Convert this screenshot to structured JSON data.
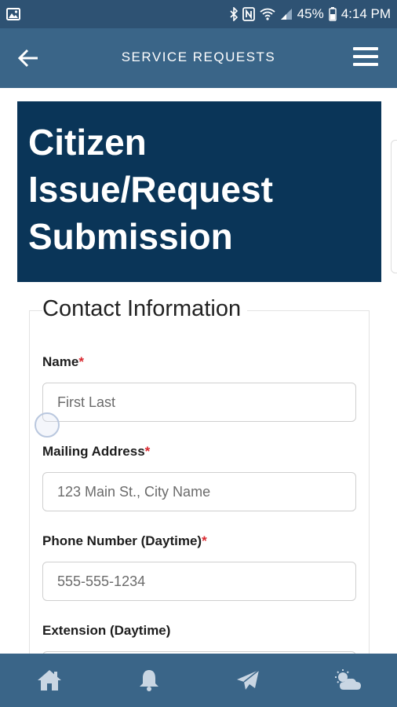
{
  "status_bar": {
    "battery": "45%",
    "time": "4:14 PM",
    "icons": [
      "image-icon",
      "bluetooth-icon",
      "nfc-icon",
      "wifi-icon",
      "signal-icon",
      "battery-icon"
    ]
  },
  "app_bar": {
    "title": "SERVICE REQUESTS",
    "back_icon": "back-arrow-icon",
    "menu_icon": "hamburger-menu-icon"
  },
  "hero": {
    "title_line1": "Citizen",
    "title_line2": "Issue/Request",
    "title_line3": "Submission"
  },
  "form": {
    "section_title": "Contact Information",
    "required_marker": "*",
    "fields": [
      {
        "label": "Name",
        "required": true,
        "placeholder": "First Last"
      },
      {
        "label": "Mailing Address",
        "required": true,
        "placeholder": "123 Main St., City Name"
      },
      {
        "label": "Phone Number (Daytime)",
        "required": true,
        "placeholder": "555-555-1234"
      },
      {
        "label": "Extension (Daytime)",
        "required": false,
        "placeholder": ""
      }
    ]
  },
  "bottom_nav": {
    "items": [
      "home-icon",
      "bell-icon",
      "send-icon",
      "weather-icon"
    ]
  },
  "colors": {
    "status_bar": "#2e5273",
    "app_bar": "#3a6588",
    "hero_bg": "#0a3558",
    "required": "#d9272e"
  }
}
